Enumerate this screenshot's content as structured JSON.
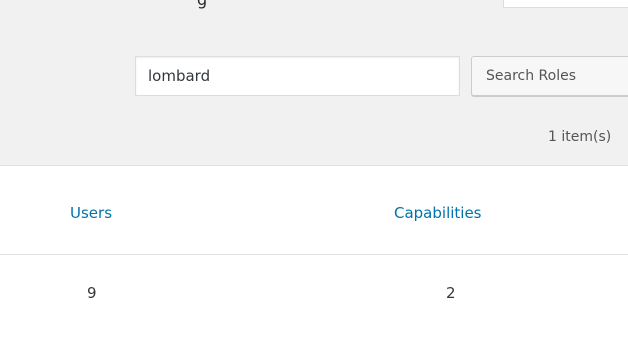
{
  "header": {
    "title_partial": "g",
    "top_box_value": ""
  },
  "search": {
    "value": "lombard",
    "button_label": "Search Roles"
  },
  "pagination": {
    "item_count": "1 item(s)"
  },
  "table": {
    "columns": [
      "Users",
      "Capabilities"
    ],
    "rows": [
      {
        "users": "9",
        "capabilities": "2"
      }
    ]
  },
  "colors": {
    "background": "#f1f1f1",
    "link": "#0073aa",
    "text": "#32373c"
  }
}
